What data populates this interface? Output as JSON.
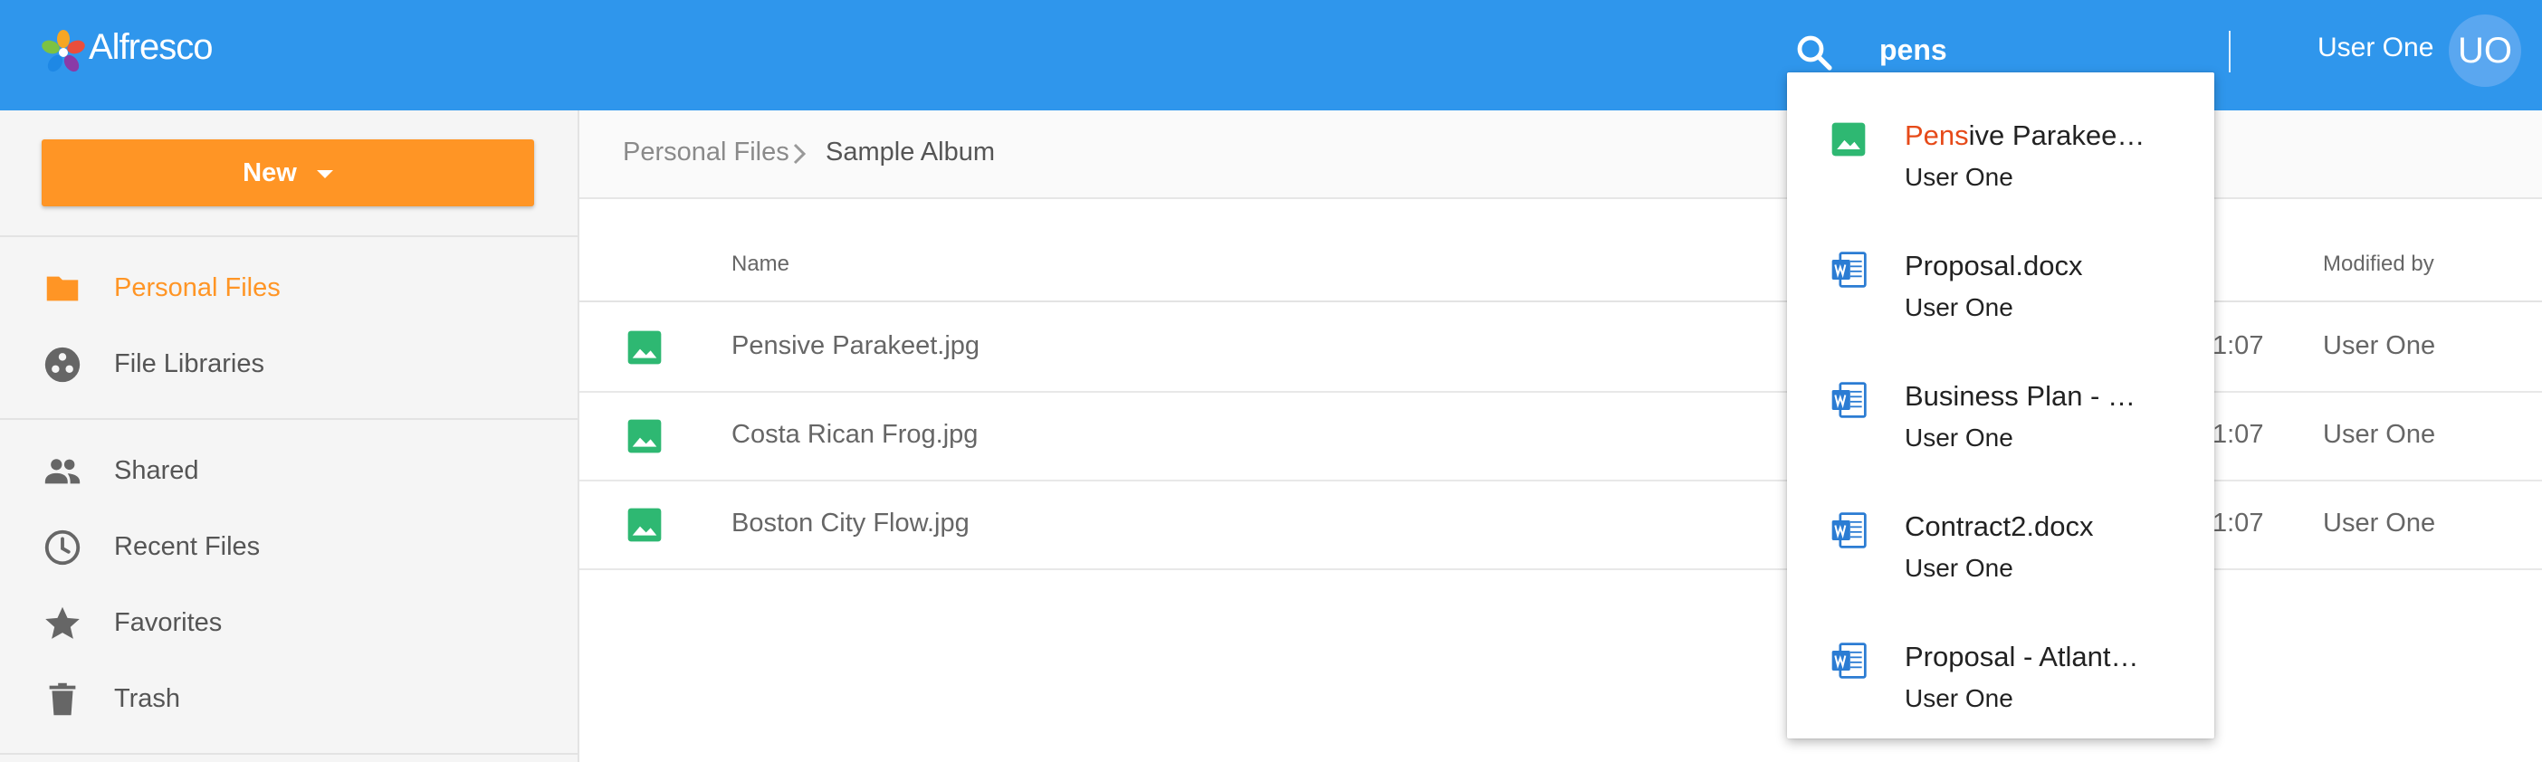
{
  "header": {
    "app_name": "Alfresco",
    "search_value": "pens",
    "user_name": "User One",
    "avatar_initials": "UO",
    "bg_color": "#2f96ec"
  },
  "sidebar": {
    "new_button": {
      "label": "New",
      "color": "#ff9525"
    },
    "primary_items": [
      {
        "label": "Personal Files",
        "icon": "folder-icon",
        "active": true
      },
      {
        "label": "File Libraries",
        "icon": "libraries-icon",
        "active": false
      }
    ],
    "secondary_items": [
      {
        "label": "Shared",
        "icon": "people-icon"
      },
      {
        "label": "Recent Files",
        "icon": "clock-icon"
      },
      {
        "label": "Favorites",
        "icon": "star-icon"
      },
      {
        "label": "Trash",
        "icon": "trash-icon"
      }
    ]
  },
  "breadcrumb": {
    "items": [
      "Personal Files",
      "Sample Album"
    ]
  },
  "table": {
    "columns": {
      "name": "Name",
      "modified_by": "Modified by"
    },
    "rows": [
      {
        "name": "Pensive Parakeet.jpg",
        "modified_partial": "1:07",
        "modified_by": "User One",
        "icon": "image-file-icon"
      },
      {
        "name": "Costa Rican Frog.jpg",
        "modified_partial": "1:07",
        "modified_by": "User One",
        "icon": "image-file-icon"
      },
      {
        "name": "Boston City Flow.jpg",
        "modified_partial": "1:07",
        "modified_by": "User One",
        "icon": "image-file-icon"
      }
    ]
  },
  "search_results": {
    "highlight_color": "#e64a19",
    "items": [
      {
        "highlight": "Pens",
        "rest": "ive Parakee…",
        "owner": "User One",
        "icon": "image-file-icon"
      },
      {
        "highlight": "",
        "rest": "Proposal.docx",
        "owner": "User One",
        "icon": "word-doc-icon"
      },
      {
        "highlight": "",
        "rest": "Business Plan - …",
        "owner": "User One",
        "icon": "word-doc-icon"
      },
      {
        "highlight": "",
        "rest": "Contract2.docx",
        "owner": "User One",
        "icon": "word-doc-icon"
      },
      {
        "highlight": "",
        "rest": "Proposal - Atlant…",
        "owner": "User One",
        "icon": "word-doc-icon"
      }
    ]
  }
}
